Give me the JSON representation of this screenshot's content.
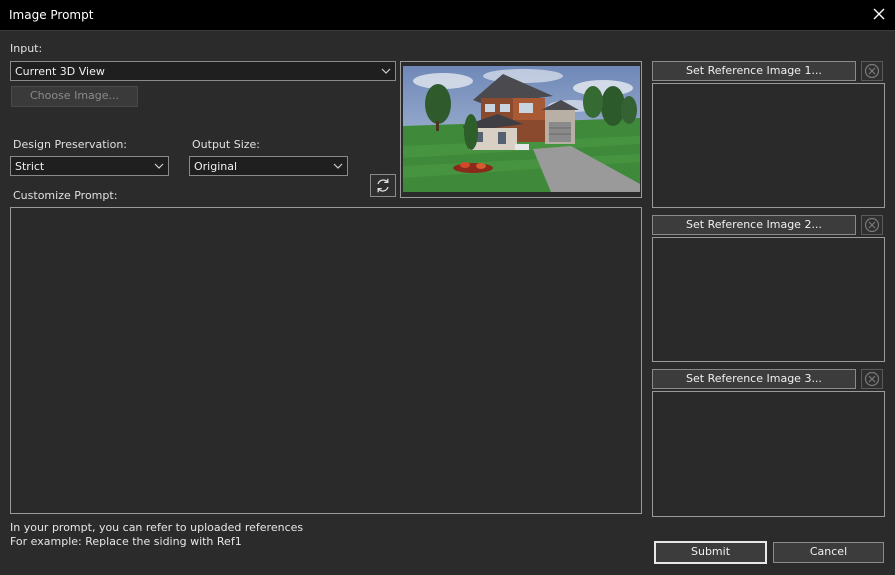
{
  "window": {
    "title": "Image Prompt"
  },
  "input": {
    "label": "Input:",
    "selected": "Current 3D View",
    "choose_button": "Choose Image..."
  },
  "design_preservation": {
    "label": "Design Preservation:",
    "selected": "Strict"
  },
  "output_size": {
    "label": "Output Size:",
    "selected": "Original"
  },
  "prompt": {
    "label": "Customize Prompt:",
    "value": ""
  },
  "references": [
    {
      "button_label": "Set Reference Image 1..."
    },
    {
      "button_label": "Set Reference Image 2..."
    },
    {
      "button_label": "Set Reference Image 3..."
    }
  ],
  "hints": {
    "line1": "In your prompt, you can refer to uploaded references",
    "line2": "For example: Replace the siding with Ref1"
  },
  "footer": {
    "submit": "Submit",
    "cancel": "Cancel"
  },
  "icons": {
    "close": "close-icon",
    "chevron": "chevron-down-icon",
    "refresh": "refresh-icon",
    "remove": "remove-circle-icon"
  }
}
